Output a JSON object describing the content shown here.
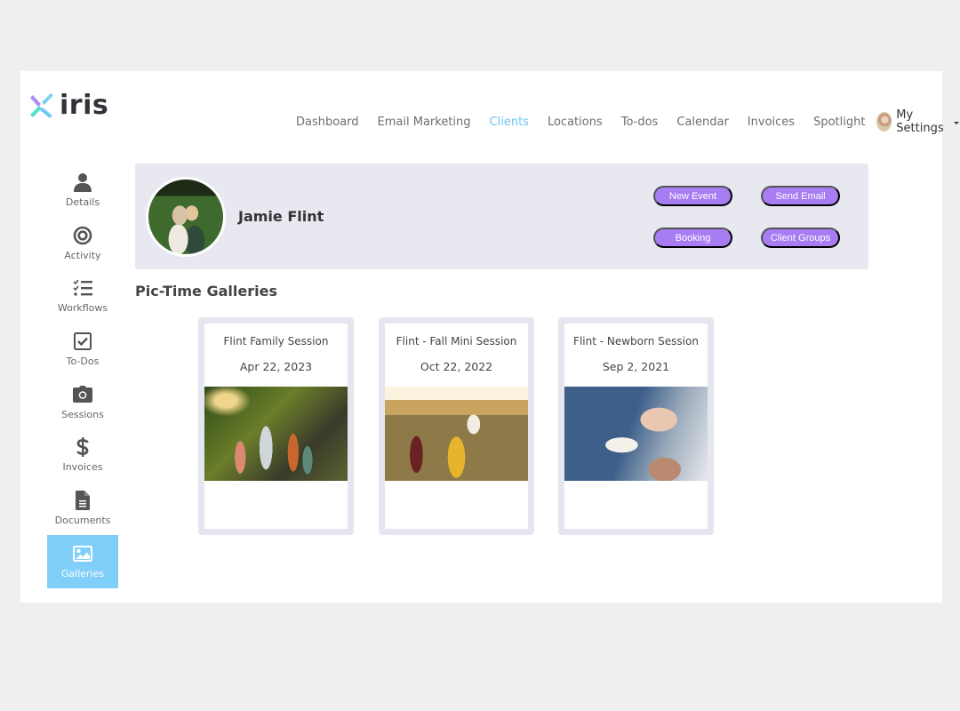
{
  "app": {
    "logo_text": "iris",
    "brand_colors": {
      "accent": "#6cc6f2",
      "button": "#a87cf3",
      "sidebar_active": "#80cff8"
    }
  },
  "topnav": {
    "items": [
      {
        "label": "Dashboard",
        "active": false
      },
      {
        "label": "Email Marketing",
        "active": false
      },
      {
        "label": "Clients",
        "active": true
      },
      {
        "label": "Locations",
        "active": false
      },
      {
        "label": "To-dos",
        "active": false
      },
      {
        "label": "Calendar",
        "active": false
      },
      {
        "label": "Invoices",
        "active": false
      },
      {
        "label": "Spotlight",
        "active": false
      }
    ],
    "settings_label": "My Settings"
  },
  "sidebar": {
    "items": [
      {
        "label": "Details",
        "icon": "user-icon"
      },
      {
        "label": "Activity",
        "icon": "target-icon"
      },
      {
        "label": "Workflows",
        "icon": "checklist-icon"
      },
      {
        "label": "To-Dos",
        "icon": "checkbox-icon"
      },
      {
        "label": "Sessions",
        "icon": "camera-icon"
      },
      {
        "label": "Invoices",
        "icon": "dollar-icon"
      },
      {
        "label": "Documents",
        "icon": "document-icon"
      },
      {
        "label": "Galleries",
        "icon": "image-icon",
        "active": true
      }
    ]
  },
  "client": {
    "name": "Jamie Flint",
    "actions": {
      "new_event": "New Event",
      "send_email": "Send Email",
      "booking": "Booking",
      "client_groups": "Client Groups"
    }
  },
  "galleries": {
    "section_title": "Pic-Time Galleries",
    "items": [
      {
        "title": "Flint Family Session",
        "date": "Apr 22, 2023"
      },
      {
        "title": "Flint - Fall Mini Session",
        "date": "Oct 22, 2022"
      },
      {
        "title": "Flint - Newborn Session",
        "date": "Sep 2, 2021"
      }
    ]
  }
}
